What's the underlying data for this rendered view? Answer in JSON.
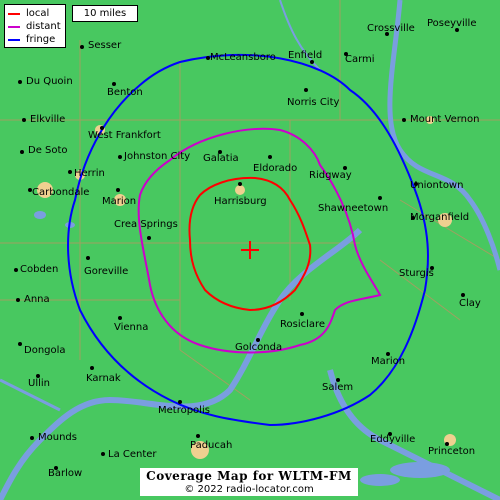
{
  "legend": {
    "items": [
      {
        "label": "local",
        "color": "#ff0000"
      },
      {
        "label": "distant",
        "color": "#cc00cc"
      },
      {
        "label": "fringe",
        "color": "#0000ff"
      }
    ]
  },
  "scale": {
    "label": "10 miles"
  },
  "footer": {
    "title": "Coverage Map for WLTM-FM",
    "copyright": "© 2022 radio-locator.com"
  },
  "colors": {
    "land": "#48c860",
    "water": "#7a9ee0",
    "urban": "#f0d090",
    "local": "#ff0000",
    "distant": "#cc00cc",
    "fringe": "#0000ff",
    "transmitter": "#ff0000"
  },
  "towns": [
    {
      "name": "Sesser"
    },
    {
      "name": "McLeansboro"
    },
    {
      "name": "Enfield"
    },
    {
      "name": "Crossville"
    },
    {
      "name": "Poseyville"
    },
    {
      "name": "Du Quoin"
    },
    {
      "name": "Benton"
    },
    {
      "name": "Carmi"
    },
    {
      "name": "Norris City"
    },
    {
      "name": "Elkville"
    },
    {
      "name": "West Frankfort"
    },
    {
      "name": "Mount Vernon"
    },
    {
      "name": "De Soto"
    },
    {
      "name": "Johnston City"
    },
    {
      "name": "Galatia"
    },
    {
      "name": "Eldorado"
    },
    {
      "name": "Ridgway"
    },
    {
      "name": "Herrin"
    },
    {
      "name": "Carbondale"
    },
    {
      "name": "Marion"
    },
    {
      "name": "Harrisburg"
    },
    {
      "name": "Uniontown"
    },
    {
      "name": "Shawneetown"
    },
    {
      "name": "Morganfield"
    },
    {
      "name": "Crea Springs"
    },
    {
      "name": "Cobden"
    },
    {
      "name": "Goreville"
    },
    {
      "name": "Sturgis"
    },
    {
      "name": "Anna"
    },
    {
      "name": "Clay"
    },
    {
      "name": "Vienna"
    },
    {
      "name": "Rosiclare"
    },
    {
      "name": "Dongola"
    },
    {
      "name": "Golconda"
    },
    {
      "name": "Marion"
    },
    {
      "name": "Ullin"
    },
    {
      "name": "Karnak"
    },
    {
      "name": "Salem"
    },
    {
      "name": "Metropolis"
    },
    {
      "name": "Mounds"
    },
    {
      "name": "Paducah"
    },
    {
      "name": "Eddyville"
    },
    {
      "name": "La Center"
    },
    {
      "name": "Princeton"
    },
    {
      "name": "Barlow"
    }
  ]
}
